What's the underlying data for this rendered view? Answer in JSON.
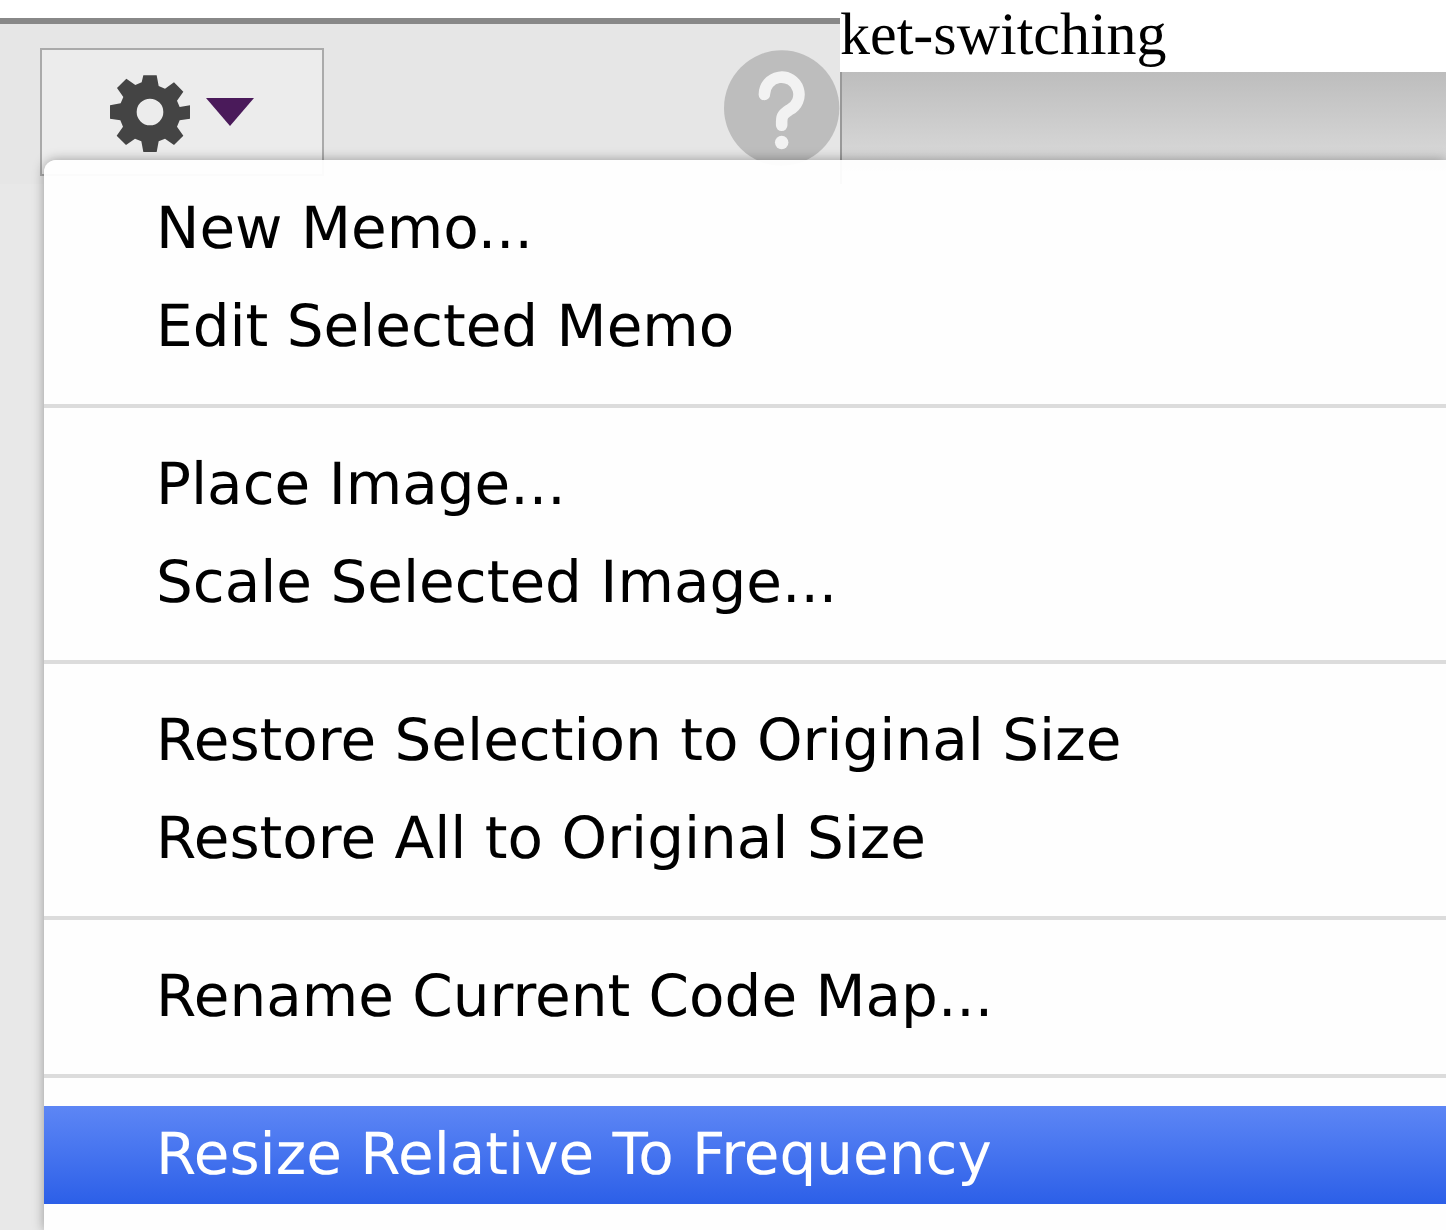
{
  "background_text": "ket-switching",
  "menu": {
    "sections": [
      {
        "items": [
          {
            "label": "New Memo...",
            "selected": false
          },
          {
            "label": "Edit Selected Memo",
            "selected": false
          }
        ]
      },
      {
        "items": [
          {
            "label": "Place Image...",
            "selected": false
          },
          {
            "label": "Scale Selected Image...",
            "selected": false
          }
        ]
      },
      {
        "items": [
          {
            "label": "Restore Selection to Original Size",
            "selected": false
          },
          {
            "label": "Restore All to Original Size",
            "selected": false
          }
        ]
      },
      {
        "items": [
          {
            "label": "Rename Current Code Map...",
            "selected": false
          }
        ]
      },
      {
        "items": [
          {
            "label": "Resize Relative To Frequency",
            "selected": true
          }
        ]
      }
    ]
  }
}
